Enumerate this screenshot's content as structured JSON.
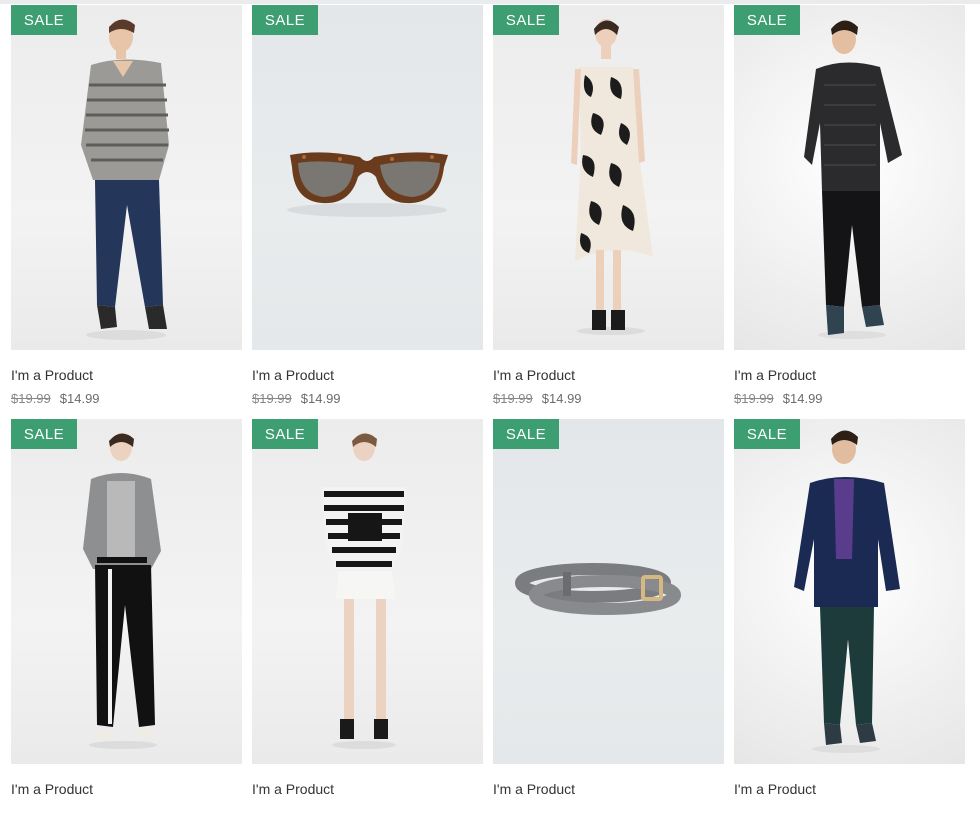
{
  "products": [
    {
      "badge": "SALE",
      "name": "I'm a Product",
      "old_price": "$19.99",
      "price": "$14.99"
    },
    {
      "badge": "SALE",
      "name": "I'm a Product",
      "old_price": "$19.99",
      "price": "$14.99"
    },
    {
      "badge": "SALE",
      "name": "I'm a Product",
      "old_price": "$19.99",
      "price": "$14.99"
    },
    {
      "badge": "SALE",
      "name": "I'm a Product",
      "old_price": "$19.99",
      "price": "$14.99"
    },
    {
      "badge": "SALE",
      "name": "I'm a Product"
    },
    {
      "badge": "SALE",
      "name": "I'm a Product"
    },
    {
      "badge": "SALE",
      "name": "I'm a Product"
    },
    {
      "badge": "SALE",
      "name": "I'm a Product"
    }
  ],
  "colors": {
    "badge": "#3d9e72",
    "image_bg": "#ececec",
    "text": "#333333"
  }
}
